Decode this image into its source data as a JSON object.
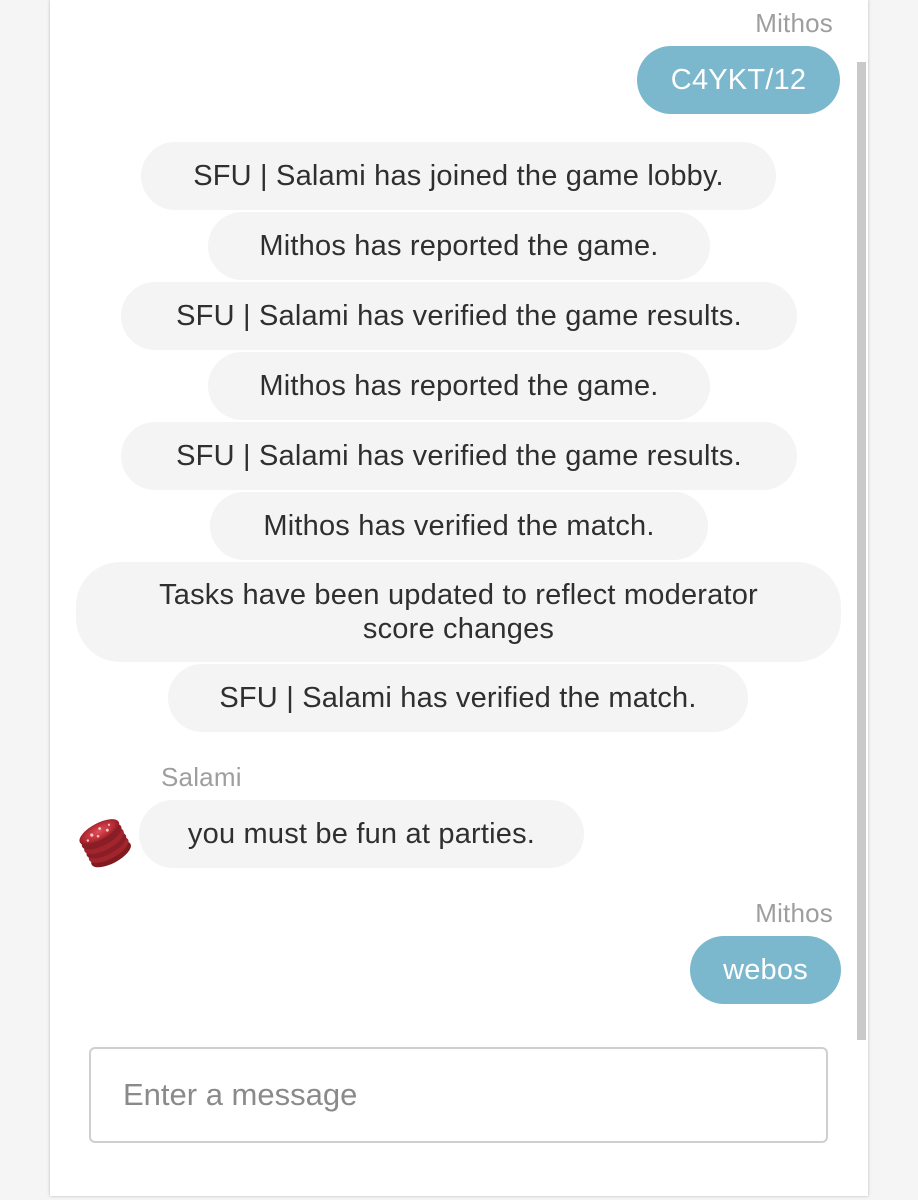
{
  "chat": {
    "messages": [
      {
        "kind": "own",
        "sender": "Mithos",
        "text": "C4YKT/12"
      },
      {
        "kind": "system",
        "text": "SFU | Salami has joined the game lobby."
      },
      {
        "kind": "system",
        "text": "Mithos has reported the game."
      },
      {
        "kind": "system",
        "text": "SFU | Salami has verified the game results."
      },
      {
        "kind": "system",
        "text": "Mithos has reported the game."
      },
      {
        "kind": "system",
        "text": "SFU | Salami has verified the game results."
      },
      {
        "kind": "system",
        "text": "Mithos has verified the match."
      },
      {
        "kind": "system",
        "text": "Tasks have been updated to reflect moderator score changes"
      },
      {
        "kind": "system",
        "text": "SFU | Salami has verified the match."
      },
      {
        "kind": "other",
        "sender": "Salami",
        "avatar": "salami-icon",
        "text": "you must be fun at parties."
      },
      {
        "kind": "own",
        "sender": "Mithos",
        "text": "webos"
      }
    ]
  },
  "composer": {
    "placeholder": "Enter a message"
  },
  "colors": {
    "own_bubble": "#7bb7cd",
    "system_bubble": "#f4f4f4",
    "sender_text": "#9e9e9e"
  }
}
